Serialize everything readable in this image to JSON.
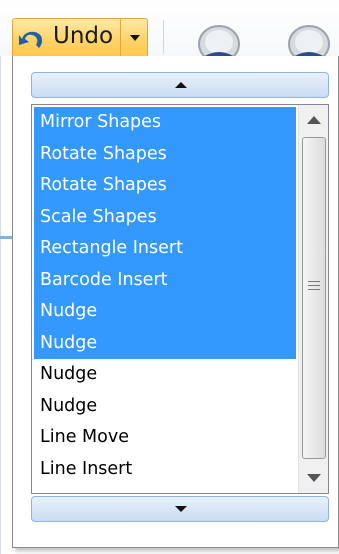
{
  "toolbar": {
    "undo_label": "Undo",
    "icons": [
      "undo-arrow-icon",
      "chevron-down-icon",
      "zoom-icon",
      "zoom-icon"
    ]
  },
  "history": {
    "items": [
      {
        "label": "Mirror Shapes",
        "selected": true
      },
      {
        "label": "Rotate Shapes",
        "selected": true
      },
      {
        "label": "Rotate Shapes",
        "selected": true
      },
      {
        "label": "Scale Shapes",
        "selected": true
      },
      {
        "label": "Rectangle Insert",
        "selected": true
      },
      {
        "label": "Barcode Insert",
        "selected": true
      },
      {
        "label": "Nudge",
        "selected": true
      },
      {
        "label": "Nudge",
        "selected": true
      },
      {
        "label": "Nudge",
        "selected": false
      },
      {
        "label": "Nudge",
        "selected": false
      },
      {
        "label": "Line Move",
        "selected": false
      },
      {
        "label": "Line Insert",
        "selected": false
      }
    ]
  },
  "colors": {
    "selection": "#3399ff",
    "button_accent": "#ffd36a",
    "scroll_button": "#c9dcf2"
  }
}
